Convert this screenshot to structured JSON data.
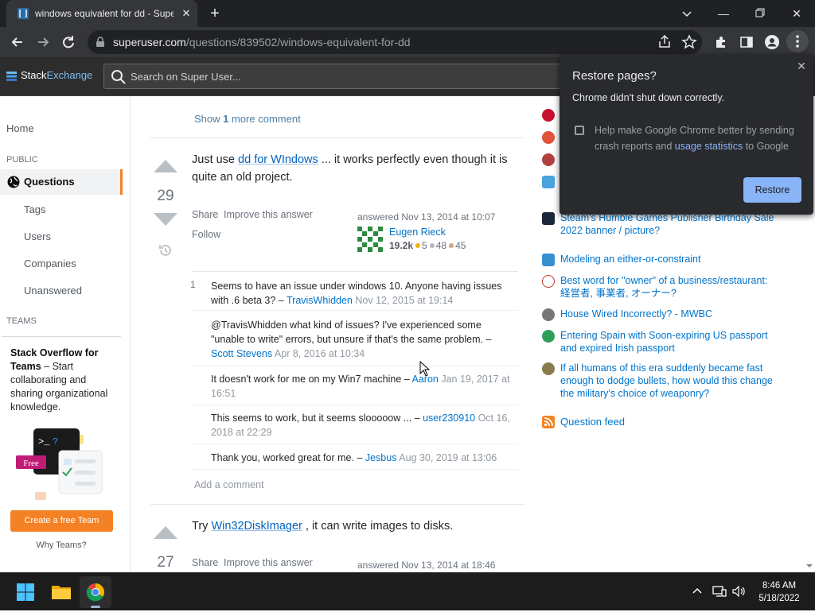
{
  "browser": {
    "tab_title": "windows equivalent for dd - Super User",
    "url_host": "superuser.com",
    "url_path": "/questions/839502/windows-equivalent-for-dd"
  },
  "se_header": {
    "logo_stack": "Stack",
    "logo_exchange": "Exchange",
    "search_placeholder": "Search on Super User..."
  },
  "leftnav": {
    "home": "Home",
    "public_label": "PUBLIC",
    "questions": "Questions",
    "tags": "Tags",
    "users": "Users",
    "companies": "Companies",
    "unanswered": "Unanswered",
    "teams_label": "TEAMS",
    "teams_title": "Stack Overflow for Teams",
    "teams_dash": " – Start collaborating and sharing organizational knowledge.",
    "teams_free": "Free",
    "create_team": "Create a free Team",
    "why_teams": "Why Teams?"
  },
  "main": {
    "show_more_pre": "Show ",
    "show_more_num": "1",
    "show_more_post": " more comment",
    "answer1": {
      "votes": "29",
      "body_pre": "Just use ",
      "body_link": "dd for WIndows",
      "body_post": " ... it works perfectly even though it is quite an old project.",
      "share": "Share",
      "improve": "Improve this answer",
      "follow": "Follow",
      "answered": "answered Nov 13, 2014 at 10:07",
      "user_name": "Eugen Rieck",
      "user_rep": "19.2k",
      "gold": "5",
      "silver": "48",
      "bronze": "45"
    },
    "comments": [
      {
        "score": "1",
        "text": "Seems to have an issue under windows 10. Anyone having issues with .6 beta 3? – ",
        "author": "TravisWhidden",
        "date": " Nov 12, 2015 at 19:14"
      },
      {
        "score": "",
        "text": "@TravisWhidden what kind of issues? I've experienced some \"unable to write\" errors, but unsure if that's the same problem. – ",
        "author": "Scott Stevens",
        "date": " Apr 8, 2016 at 10:34"
      },
      {
        "score": "",
        "text": "It doesn't work for me on my Win7 machine – ",
        "author": "Aaron",
        "date": " Jan 19, 2017 at 16:51"
      },
      {
        "score": "",
        "text": "This seems to work, but it seems slooooow ... – ",
        "author": "user230910",
        "date": " Oct 16, 2018 at 22:29"
      },
      {
        "score": "",
        "text": "Thank you, worked great for me. – ",
        "author": "Jesbus",
        "date": " Aug 30, 2019 at 13:06"
      }
    ],
    "add_comment": "Add a comment",
    "answer2": {
      "votes": "27",
      "body_pre": "Try ",
      "body_link": "Win32DiskImager",
      "body_post": " , it can write images to disks.",
      "share": "Share",
      "improve": "Improve this answer",
      "answered": "answered Nov 13, 2014 at 18:46"
    }
  },
  "hot_questions": [
    {
      "title": "Steam's Humble Games Publisher Birthday Sale 2022 banner / picture?",
      "color": "#1b2838"
    },
    {
      "title": "Modeling an either-or-constraint",
      "color": "#3a8fd1"
    },
    {
      "title": "Best word for \"owner\" of a business/restaurant: 経営者, 事業者, オーナー?",
      "color": "#c0392b"
    },
    {
      "title": "House Wired Incorrectly? - MWBC",
      "color": "#777777"
    },
    {
      "title": "Entering Spain with Soon-expiring US passport and expired Irish passport",
      "color": "#2e9f5b"
    },
    {
      "title": "If all humans of this era suddenly became fast enough to dodge bullets, how would this change the military's choice of weaponry?",
      "color": "#8a7b4f"
    }
  ],
  "question_feed": "Question feed",
  "restore_popup": {
    "title": "Restore pages?",
    "message": "Chrome didn't shut down correctly.",
    "checkbox_pre": "Help make Google Chrome better by sending crash reports and ",
    "checkbox_link": "usage statistics",
    "checkbox_post": " to Google",
    "button": "Restore"
  },
  "taskbar": {
    "time": "8:46 AM",
    "date": "5/18/2022"
  }
}
